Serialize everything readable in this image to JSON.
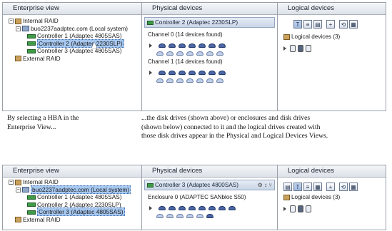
{
  "top": {
    "enterprise": {
      "header": "Enterprise view",
      "tree": [
        {
          "label": "Internal RAID",
          "level": 0,
          "expander": "−",
          "icon": "raid-icon"
        },
        {
          "label": "buo2237aadptec.com (Local system)",
          "level": 1,
          "expander": "−",
          "icon": "host-icon",
          "selected": false
        },
        {
          "label": "Controller 1 (Adaptec 4805SAS)",
          "level": 2,
          "icon": "controller-icon",
          "selected": false
        },
        {
          "label": "Controller 2 (Adaptec 2230SLP)",
          "level": 2,
          "icon": "controller-icon",
          "selected": true
        },
        {
          "label": "Controller 3 (Adaptec 4805SAS)",
          "level": 2,
          "icon": "controller-icon",
          "selected": false
        },
        {
          "label": "External RAID",
          "level": 0,
          "icon": "raid-icon"
        }
      ]
    },
    "physical": {
      "header": "Physical devices",
      "controller_bar": "Controller 2 (Adaptec 2230SLP)",
      "channels": [
        {
          "label": "Channel 0    (14 devices found)",
          "rows": [
            7,
            7
          ]
        },
        {
          "label": "Channel 1    (14 devices found)",
          "rows": [
            7,
            7
          ]
        }
      ]
    },
    "logical": {
      "header": "Logical devices",
      "toolbar": [
        "T",
        "≡",
        "▤",
        "+",
        "⟲",
        "▦"
      ],
      "label": "Logical devices (3)",
      "volumes": 3
    }
  },
  "captions": {
    "left": "By selecting a HBA in the\nEnterprise View...",
    "right": "...the disk drives (shown above) or enclosures and disk drives\n(shown below) connected to it and the logical drives created with\nthose disk drives appear in the Physical and Logical Devices Views."
  },
  "bottom": {
    "enterprise": {
      "header": "Enterprise view",
      "tree": [
        {
          "label": "Internal RAID",
          "level": 0,
          "expander": "−",
          "icon": "raid-icon"
        },
        {
          "label": "buo2237aadptec.com (Local system)",
          "level": 1,
          "expander": "−",
          "icon": "host-icon",
          "selected": true
        },
        {
          "label": "Controller 1 (Adaptec 4805SAS)",
          "level": 2,
          "icon": "controller-icon",
          "selected": false
        },
        {
          "label": "Controller 2 (Adaptec 2230SLP)",
          "level": 2,
          "icon": "controller-icon",
          "selected": false
        },
        {
          "label": "Controller 3 (Adaptec 4805SAS)",
          "level": 2,
          "icon": "controller-icon",
          "selected": true
        },
        {
          "label": "External RAID",
          "level": 0,
          "icon": "raid-icon"
        }
      ]
    },
    "physical": {
      "header": "Physical devices",
      "controller_bar": "Controller 3 (Adaptec 4800SAS)",
      "bar_icons": "⚙ ↕ ⑂",
      "enclosure": {
        "label": "Enclosure 0 (ADAPTEC SANbloc S50)",
        "rows": [
          8,
          6
        ]
      }
    },
    "logical": {
      "header": "Logical devices",
      "toolbar": [
        "▤",
        "T",
        "≡",
        "▦",
        "+",
        "⟲",
        "▦"
      ],
      "label": "Logical devices (3)",
      "volumes": 3
    }
  },
  "colors": {
    "selection": "#a6c7ef",
    "controller": "#3f9a47",
    "disk": "#4b67a6"
  }
}
